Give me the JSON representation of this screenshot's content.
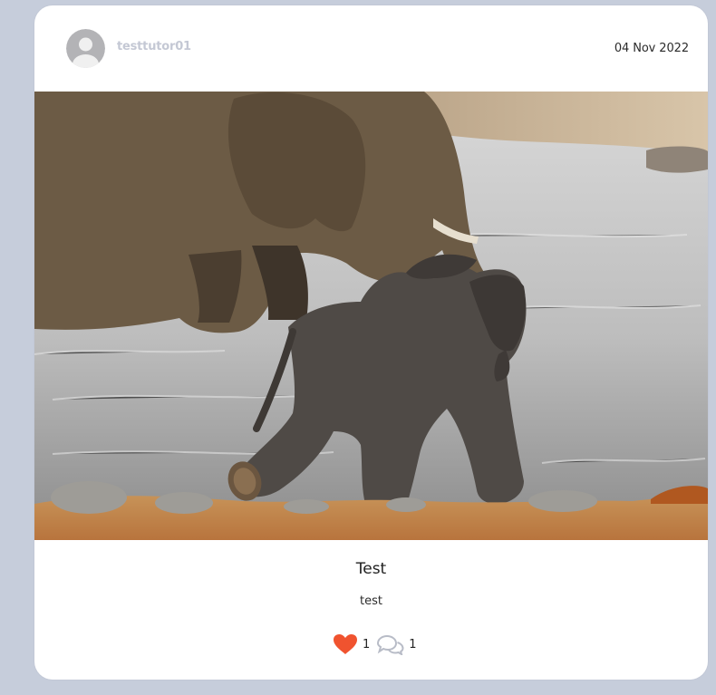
{
  "post": {
    "author": "testtutor01",
    "date": "04 Nov 2022",
    "title": "Test",
    "body": "test",
    "likes": "1",
    "comments": "1"
  },
  "icons": {
    "avatar": "default-user-avatar",
    "like": "heart-icon",
    "comment": "chat-bubbles-icon"
  },
  "colors": {
    "page_background": "#c6cddb",
    "card_background": "#ffffff",
    "username": "#c4c8d4",
    "heart": "#f0532f",
    "comment_icon": "#b8bcc7"
  }
}
